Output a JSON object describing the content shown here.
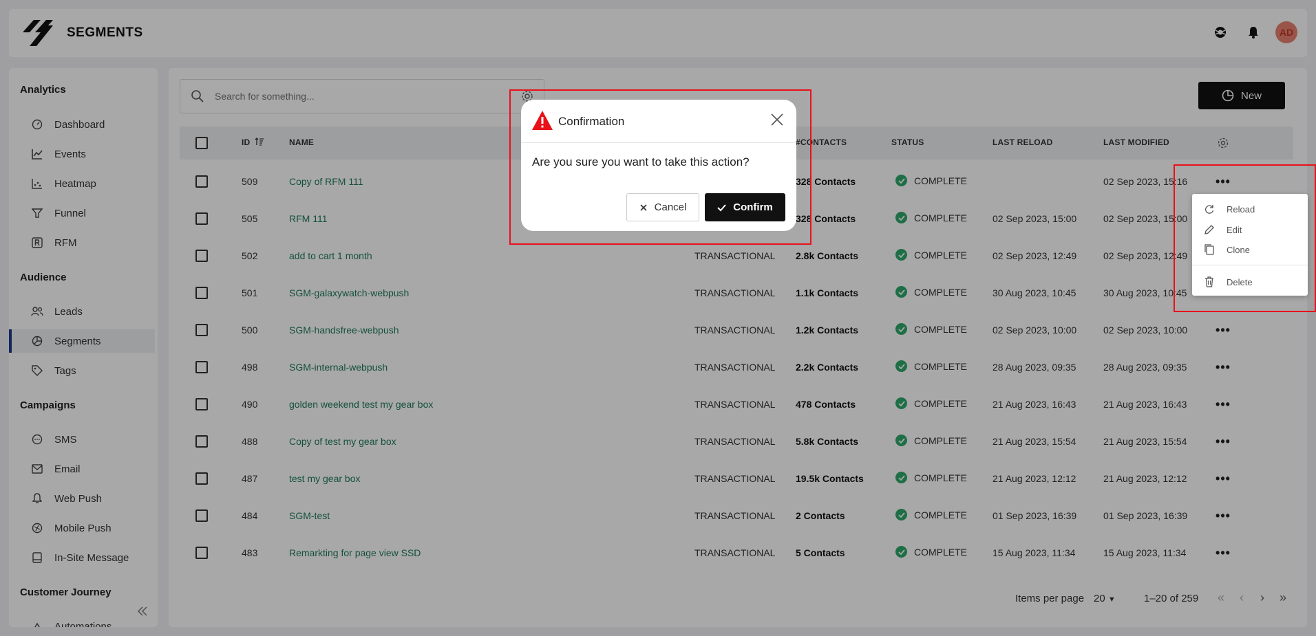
{
  "app": {
    "title": "SEGMENTS",
    "avatar_initials": "AD"
  },
  "sidebar": {
    "sections": [
      {
        "title": "Analytics"
      },
      {
        "title": "Audience"
      },
      {
        "title": "Campaigns"
      },
      {
        "title": "Customer Journey"
      }
    ],
    "items": [
      {
        "label": "Dashboard",
        "icon": "dashboard-icon"
      },
      {
        "label": "Events",
        "icon": "line-chart-icon"
      },
      {
        "label": "Heatmap",
        "icon": "scatter-icon"
      },
      {
        "label": "Funnel",
        "icon": "funnel-icon"
      },
      {
        "label": "RFM",
        "icon": "rfm-icon"
      },
      {
        "label": "Leads",
        "icon": "users-icon"
      },
      {
        "label": "Segments",
        "icon": "pie-icon",
        "active": true
      },
      {
        "label": "Tags",
        "icon": "tag-icon"
      },
      {
        "label": "SMS",
        "icon": "sms-icon"
      },
      {
        "label": "Email",
        "icon": "email-icon"
      },
      {
        "label": "Web Push",
        "icon": "bell-icon"
      },
      {
        "label": "Mobile Push",
        "icon": "mobile-push-icon"
      },
      {
        "label": "In-Site Message",
        "icon": "message-icon"
      },
      {
        "label": "Automations",
        "icon": "automation-icon"
      }
    ]
  },
  "search": {
    "placeholder": "Search for something..."
  },
  "toolbar": {
    "new_label": "New"
  },
  "table": {
    "headers": {
      "id": "ID",
      "name": "NAME",
      "contacts": "#CONTACTS",
      "status": "STATUS",
      "last_reload": "LAST RELOAD",
      "last_modified": "LAST MODIFIED"
    },
    "rows": [
      {
        "id": "509",
        "name": "Copy of RFM 111",
        "type": "",
        "contacts": "328 Contacts",
        "status": "COMPLETE",
        "last_reload": "",
        "last_modified": "02 Sep 2023, 15:16"
      },
      {
        "id": "505",
        "name": "RFM 111",
        "type": "",
        "contacts": "328 Contacts",
        "status": "COMPLETE",
        "last_reload": "02 Sep 2023, 15:00",
        "last_modified": "02 Sep 2023, 15:00"
      },
      {
        "id": "502",
        "name": "add to cart 1 month",
        "type": "TRANSACTIONAL",
        "contacts": "2.8k Contacts",
        "status": "COMPLETE",
        "last_reload": "02 Sep 2023, 12:49",
        "last_modified": "02 Sep 2023, 12:49"
      },
      {
        "id": "501",
        "name": "SGM-galaxywatch-webpush",
        "type": "TRANSACTIONAL",
        "contacts": "1.1k Contacts",
        "status": "COMPLETE",
        "last_reload": "30 Aug 2023, 10:45",
        "last_modified": "30 Aug 2023, 10:45"
      },
      {
        "id": "500",
        "name": "SGM-handsfree-webpush",
        "type": "TRANSACTIONAL",
        "contacts": "1.2k Contacts",
        "status": "COMPLETE",
        "last_reload": "02 Sep 2023, 10:00",
        "last_modified": "02 Sep 2023, 10:00"
      },
      {
        "id": "498",
        "name": "SGM-internal-webpush",
        "type": "TRANSACTIONAL",
        "contacts": "2.2k Contacts",
        "status": "COMPLETE",
        "last_reload": "28 Aug 2023, 09:35",
        "last_modified": "28 Aug 2023, 09:35"
      },
      {
        "id": "490",
        "name": "golden weekend test my gear box",
        "type": "TRANSACTIONAL",
        "contacts": "478 Contacts",
        "status": "COMPLETE",
        "last_reload": "21 Aug 2023, 16:43",
        "last_modified": "21 Aug 2023, 16:43"
      },
      {
        "id": "488",
        "name": "Copy of test my gear box",
        "type": "TRANSACTIONAL",
        "contacts": "5.8k Contacts",
        "status": "COMPLETE",
        "last_reload": "21 Aug 2023, 15:54",
        "last_modified": "21 Aug 2023, 15:54"
      },
      {
        "id": "487",
        "name": "test my gear box",
        "type": "TRANSACTIONAL",
        "contacts": "19.5k Contacts",
        "status": "COMPLETE",
        "last_reload": "21 Aug 2023, 12:12",
        "last_modified": "21 Aug 2023, 12:12"
      },
      {
        "id": "484",
        "name": "SGM-test",
        "type": "TRANSACTIONAL",
        "contacts": "2 Contacts",
        "status": "COMPLETE",
        "last_reload": "01 Sep 2023, 16:39",
        "last_modified": "01 Sep 2023, 16:39"
      },
      {
        "id": "483",
        "name": "Remarkting for page view SSD",
        "type": "TRANSACTIONAL",
        "contacts": "5 Contacts",
        "status": "COMPLETE",
        "last_reload": "15 Aug 2023, 11:34",
        "last_modified": "15 Aug 2023, 11:34"
      }
    ]
  },
  "pagination": {
    "items_per_page_label": "Items per page",
    "items_per_page": "20",
    "range": "1–20 of 259"
  },
  "context_menu": {
    "items": [
      {
        "label": "Reload"
      },
      {
        "label": "Edit"
      },
      {
        "label": "Clone"
      },
      {
        "label": "Delete"
      }
    ]
  },
  "dialog": {
    "title": "Confirmation",
    "message": "Are you sure you want to take this action?",
    "cancel_label": "Cancel",
    "confirm_label": "Confirm"
  },
  "colors": {
    "accent": "#111111",
    "status_complete": "#2ea86b",
    "warning": "#e8111a",
    "name_link": "#1f7a5c"
  }
}
